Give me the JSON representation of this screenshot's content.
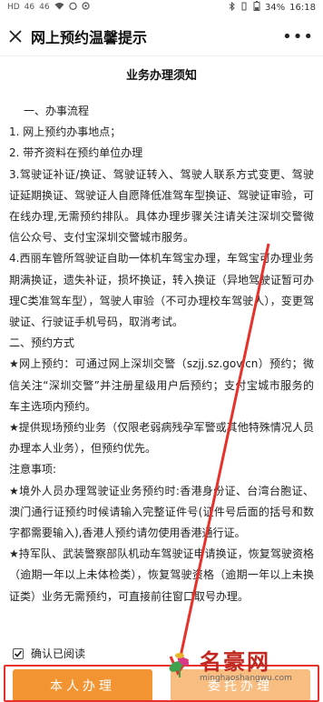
{
  "status_bar": {
    "left_icons": [
      "HD",
      "46",
      "46",
      "wifi-icon",
      "alarm-icon",
      "location-icon"
    ],
    "battery": "34%",
    "time": "16:18"
  },
  "nav": {
    "title": "网上预约温馨提示",
    "more": "•••"
  },
  "document": {
    "title": "业务办理须知",
    "paragraphs": [
      "一、办事流程",
      "1.    网上预约办事地点；",
      "2.    带齐资料在预约单位办理",
      "3.驾驶证补证/换证、驾驶证转入、驾驶人联系方式变更、驾驶证延期换证、驾驶证人自愿降低准驾车型换证、驾驶证审验，可在线办理,无需预约排队。具体办理步骤关注请关注深圳交警微信公众号、支付宝深圳交警城市服务。",
      "4.西丽车管所驾驶证自助一体机车驾宝办理，车驾宝可办理业务期满换证，遗失补证，损坏换证，转入换证（异地驾驶证暂可办理C类准驾车型），驾驶人审验（不可办理校车驾驶人），变更驾驶证、行驶证手机号码，取消考试。",
      "二、预约方式",
      "★网上预约：可通过网上深圳交警（szjj.sz.gov.cn）预约；微信关注“深圳交警”并注册星级用户后预约；支付宝城市服务的车主选项内预约。",
      "★提供现场预约业务（仅限老弱病残孕军警或其他特殊情况人员办理本人业务），但预约优先。",
      "注意事项:",
      "★境外人员办理驾驶证业务预约时:香港身份证、台湾台胞证、澳门通行证预约时候请输入完整证件号(证件号后面的括号和数字都需要输入),香港人预约请勿使用香港通行证。",
      "★持军队、武装警察部队机动车驾驶证申请换证，恢复驾驶资格（逾期一年以上未体检类），恢复驾驶资格（逾期一年以上未换证类）业务无需预约，可直接前往窗口取号办理。"
    ]
  },
  "confirm": {
    "checked": true,
    "label": "确认已阅读"
  },
  "buttons": {
    "personal": "本人办理",
    "other": "委托办理"
  },
  "watermark": {
    "brand": "名豪网",
    "url": "minghaoshangwu.com"
  },
  "colors": {
    "primary_orange": "#f39433",
    "highlight_red": "#e8312a"
  }
}
